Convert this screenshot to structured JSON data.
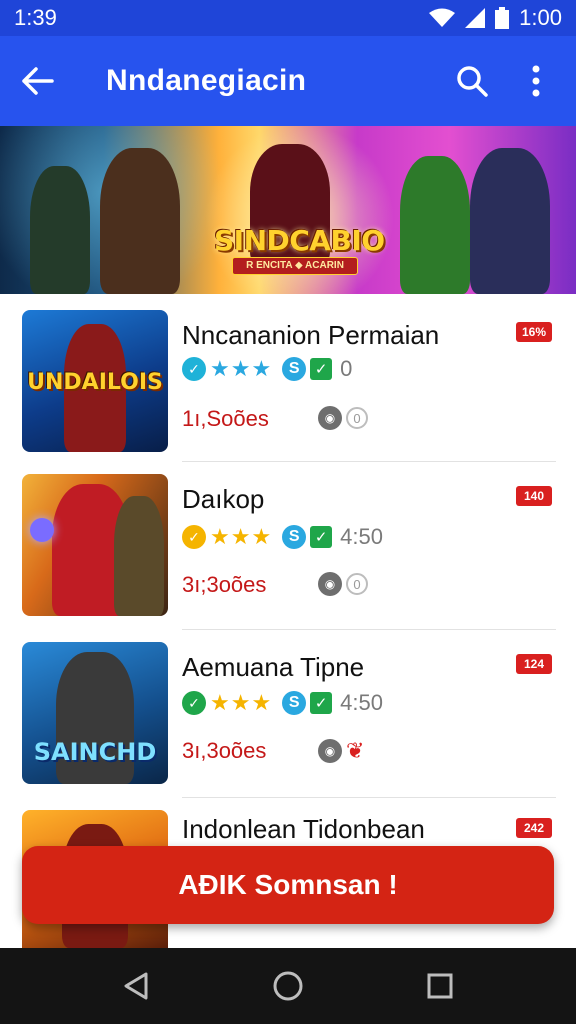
{
  "status_bar": {
    "time": "1:39",
    "clock": "1:00"
  },
  "app_bar": {
    "title": "Nndanegiacin"
  },
  "banner": {
    "logo": "SINDCABIO",
    "subtitle": "R ENCITA ◆ ACARIN"
  },
  "items": [
    {
      "name": "Nncananion Permaian",
      "rating": "0",
      "count": "1ı,Soões",
      "badge": "16%",
      "thumb_text": "UNDAILOIS",
      "stars": "★★★"
    },
    {
      "name": "Daıkop",
      "rating": "4:50",
      "count": "3ı;3oões",
      "badge": "140",
      "thumb_text": "",
      "stars": "★★★"
    },
    {
      "name": "Aemuana Tipne",
      "rating": "4:50",
      "count": "3ı,3oões",
      "badge": "124",
      "thumb_text": "SAINCHD",
      "stars": "★★★"
    },
    {
      "name": "Indonlean Tidonbean",
      "badge": "242"
    }
  ],
  "cta": {
    "label": "AĐIK Somnsan !"
  },
  "colors": {
    "primary": "#2753ee",
    "status": "#1f45d8",
    "accent_red": "#d42414"
  }
}
